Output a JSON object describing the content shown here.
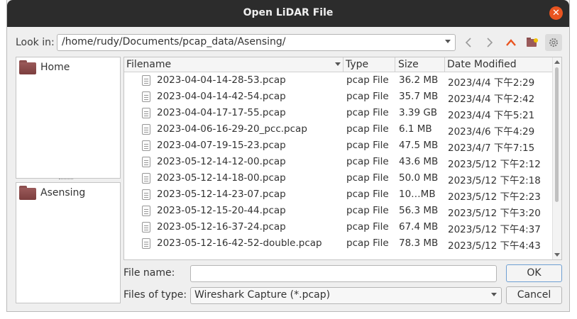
{
  "window": {
    "title": "Open LiDAR File",
    "close_icon": "close-icon"
  },
  "toolbar": {
    "look_in_label": "Look in:",
    "path": "/home/rudy/Documents/pcap_data/Asensing/",
    "icons": [
      "back-icon",
      "forward-icon",
      "parent-directory-icon",
      "new-folder-icon",
      "settings-icon"
    ],
    "accent_color": "#e95420"
  },
  "sidebar": {
    "places": [
      "Home"
    ],
    "recent": [
      "Asensing"
    ]
  },
  "file_list": {
    "headers": {
      "filename": "Filename",
      "type": "Type",
      "size": "Size",
      "date": "Date Modified"
    },
    "files": [
      {
        "name": "2023-04-04-14-28-53.pcap",
        "type": "pcap File",
        "size": "36.2 MB",
        "date": "2023/4/4 下午2:29"
      },
      {
        "name": "2023-04-04-14-42-54.pcap",
        "type": "pcap File",
        "size": "35.7 MB",
        "date": "2023/4/4 下午2:42"
      },
      {
        "name": "2023-04-04-17-17-55.pcap",
        "type": "pcap File",
        "size": "3.39 GB",
        "date": "2023/4/4 下午5:21"
      },
      {
        "name": "2023-04-06-16-29-20_pcc.pcap",
        "type": "pcap File",
        "size": "6.1 MB",
        "date": "2023/4/6 下午4:29"
      },
      {
        "name": "2023-04-07-19-15-23.pcap",
        "type": "pcap File",
        "size": "47.5 MB",
        "date": "2023/4/7 下午7:15"
      },
      {
        "name": "2023-05-12-14-12-00.pcap",
        "type": "pcap File",
        "size": "43.6 MB",
        "date": "2023/5/12 下午2:12"
      },
      {
        "name": "2023-05-12-14-18-00.pcap",
        "type": "pcap File",
        "size": "50.0 MB",
        "date": "2023/5/12 下午2:18"
      },
      {
        "name": "2023-05-12-14-23-07.pcap",
        "type": "pcap File",
        "size": "10…MB",
        "date": "2023/5/12 下午2:23"
      },
      {
        "name": "2023-05-12-15-20-44.pcap",
        "type": "pcap File",
        "size": "56.3 MB",
        "date": "2023/5/12 下午3:20"
      },
      {
        "name": "2023-05-12-16-37-24.pcap",
        "type": "pcap File",
        "size": "67.4 MB",
        "date": "2023/5/12 下午4:37"
      },
      {
        "name": "2023-05-12-16-42-52-double.pcap",
        "type": "pcap File",
        "size": "78.3 MB",
        "date": "2023/5/12 下午4:43"
      }
    ]
  },
  "form": {
    "file_name_label": "File name:",
    "file_name_value": "",
    "file_type_label": "Files of type:",
    "file_type_value": "Wireshark Capture (*.pcap)",
    "ok_label": "OK",
    "cancel_label": "Cancel"
  }
}
